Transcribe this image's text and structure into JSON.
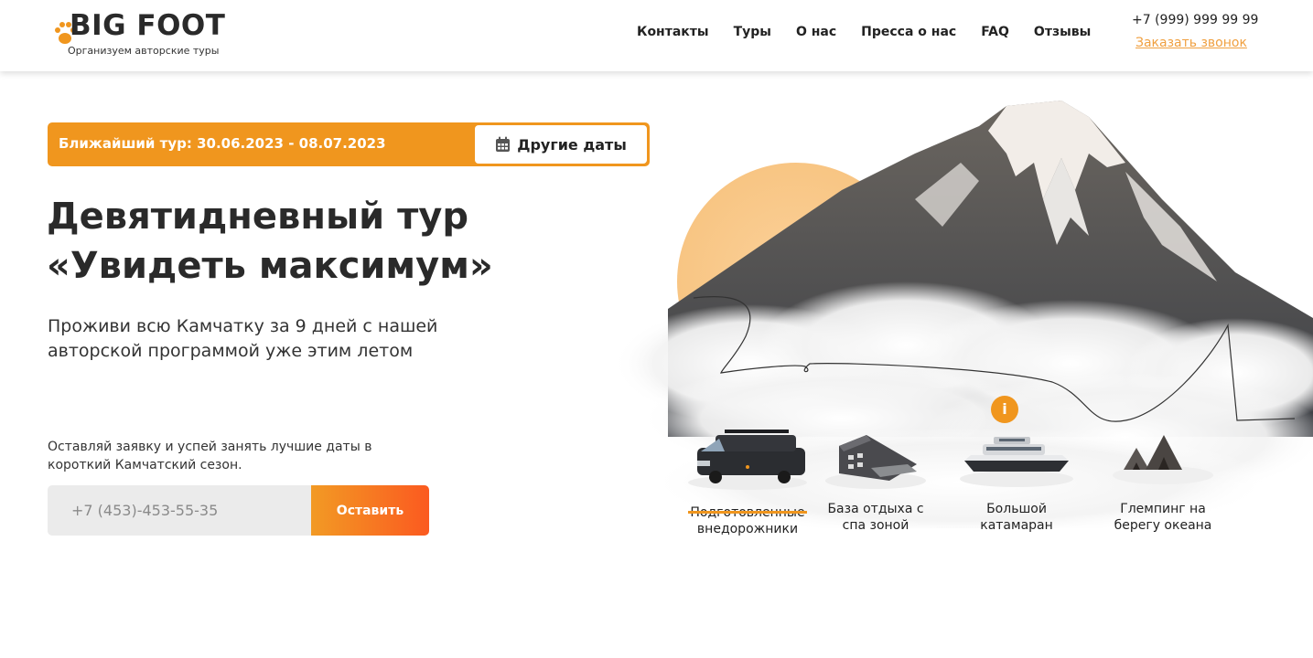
{
  "header": {
    "logo_text": "BIG FOOT",
    "logo_tagline": "Организуем авторские туры",
    "nav": [
      "Контакты",
      "Туры",
      "О нас",
      "Пресса о нас",
      "FAQ",
      "Отзывы"
    ],
    "phone": "+7 (999) 999 99 99",
    "callback_label": "Заказать звонок"
  },
  "tour": {
    "nearest_label": "Ближайший тур: 30.06.2023 - 08.07.2023",
    "other_dates_label": "Другие даты",
    "calendar_icon": "calendar-icon"
  },
  "hero": {
    "title_line1": "Девятидневный тур",
    "title_line2": "«Увидеть максимум»",
    "subtitle": "Проживи всю Камчатку за 9 дней с нашей авторской программой уже этим летом"
  },
  "form": {
    "note": "Оставляй заявку и успей занять лучшие даты в короткий Камчатский сезон.",
    "phone_placeholder": "+7 (453)-453-55-35",
    "submit_label": "Оставить"
  },
  "features": {
    "info_label": "i",
    "items": [
      {
        "label": "Подготовленные внедорожники",
        "icon": "offroad-truck-icon",
        "active": true
      },
      {
        "label": "База отдыха с спа зоной",
        "icon": "resort-building-icon",
        "active": false
      },
      {
        "label": "Большой катамаран",
        "icon": "catamaran-icon",
        "active": false
      },
      {
        "label": "Глемпинг на берегу океана",
        "icon": "glamping-tent-icon",
        "active": false
      }
    ]
  },
  "colors": {
    "accent": "#f0961e",
    "accent_dark": "#fb5a20",
    "link": "#f0a040",
    "text": "#222222"
  }
}
